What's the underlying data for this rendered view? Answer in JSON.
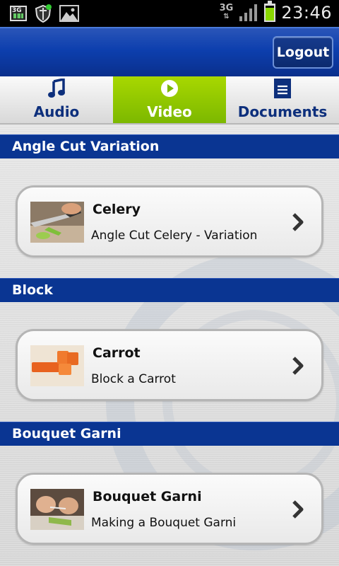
{
  "status_bar": {
    "network": "3G",
    "time": "23:46",
    "battery_level": 0.88,
    "left_icons": [
      "3g-data-icon",
      "shield-icon",
      "gallery-icon"
    ],
    "right_icons": [
      "signal-icon",
      "battery-icon"
    ]
  },
  "header": {
    "logout_label": "Logout"
  },
  "tabs": [
    {
      "label": "Audio",
      "icon": "music-note-icon",
      "active": false
    },
    {
      "label": "Video",
      "icon": "play-icon",
      "active": true
    },
    {
      "label": "Documents",
      "icon": "document-icon",
      "active": false
    }
  ],
  "sections": [
    {
      "title": "Angle Cut Variation",
      "items": [
        {
          "title": "Celery",
          "subtitle": "Angle Cut Celery - Variation",
          "thumb": "celery-thumbnail"
        }
      ]
    },
    {
      "title": "Block",
      "items": [
        {
          "title": "Carrot",
          "subtitle": "Block a Carrot",
          "thumb": "carrot-thumbnail"
        }
      ]
    },
    {
      "title": "Bouquet Garni",
      "items": [
        {
          "title": "Bouquet Garni",
          "subtitle": "Making a Bouquet Garni",
          "thumb": "bouquet-garni-thumbnail"
        }
      ]
    }
  ],
  "colors": {
    "header_blue": "#0d3fae",
    "section_blue": "#0a3592",
    "active_tab_green": "#8cc800",
    "tab_text_blue": "#0d2f7c"
  }
}
